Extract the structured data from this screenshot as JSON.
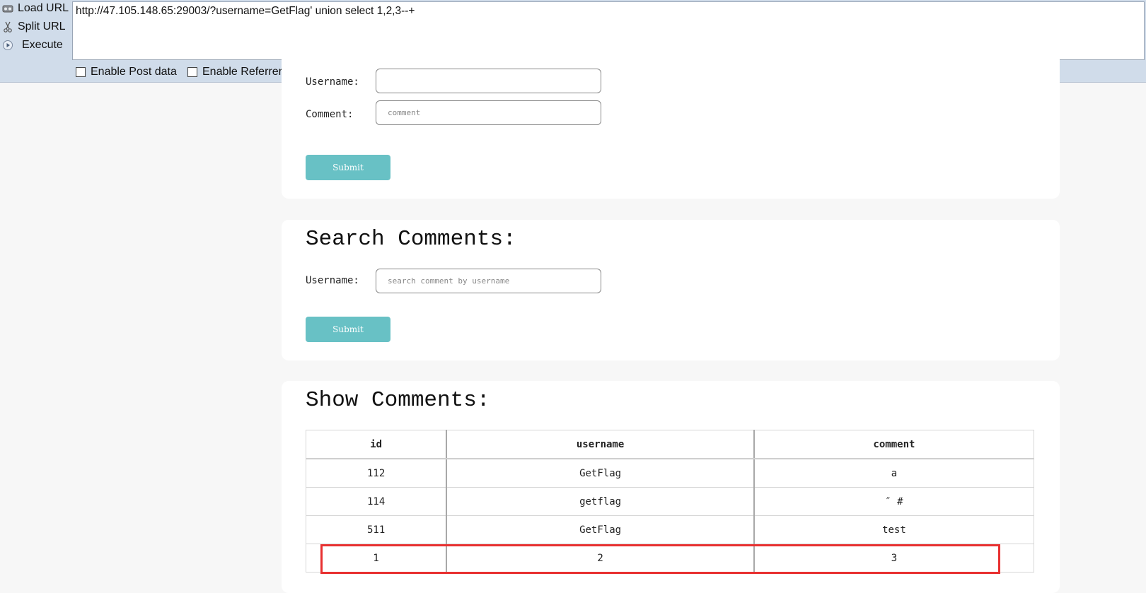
{
  "hackbar": {
    "actions": [
      {
        "label": "Load URL",
        "icon": "load-url-icon"
      },
      {
        "label": "Split URL",
        "icon": "scissors-icon"
      },
      {
        "label": "Execute",
        "icon": "play-icon"
      }
    ],
    "url": "http://47.105.148.65:29003/?username=GetFlag' union select 1,2,3--+",
    "checkboxes": [
      {
        "label": "Enable Post data",
        "checked": false
      },
      {
        "label": "Enable Referrer",
        "checked": false
      }
    ]
  },
  "add_form": {
    "username_label": "Username:",
    "comment_label": "Comment:",
    "comment_placeholder": "comment",
    "submit_label": "Submit"
  },
  "search": {
    "title": "Search Comments:",
    "username_label": "Username:",
    "placeholder": "search comment by username",
    "submit_label": "Submit"
  },
  "show": {
    "title": "Show Comments:",
    "columns": [
      "id",
      "username",
      "comment"
    ],
    "rows": [
      [
        "112",
        "GetFlag",
        "a"
      ],
      [
        "114",
        "getflag",
        "″ #"
      ],
      [
        "511",
        "GetFlag",
        "test"
      ],
      [
        "1",
        "2",
        "3"
      ]
    ]
  },
  "colors": {
    "hackbar_bg": "#d0dcea",
    "page_bg": "#f7f7f7",
    "button": "#68c1c5",
    "highlight": "#e83030"
  }
}
